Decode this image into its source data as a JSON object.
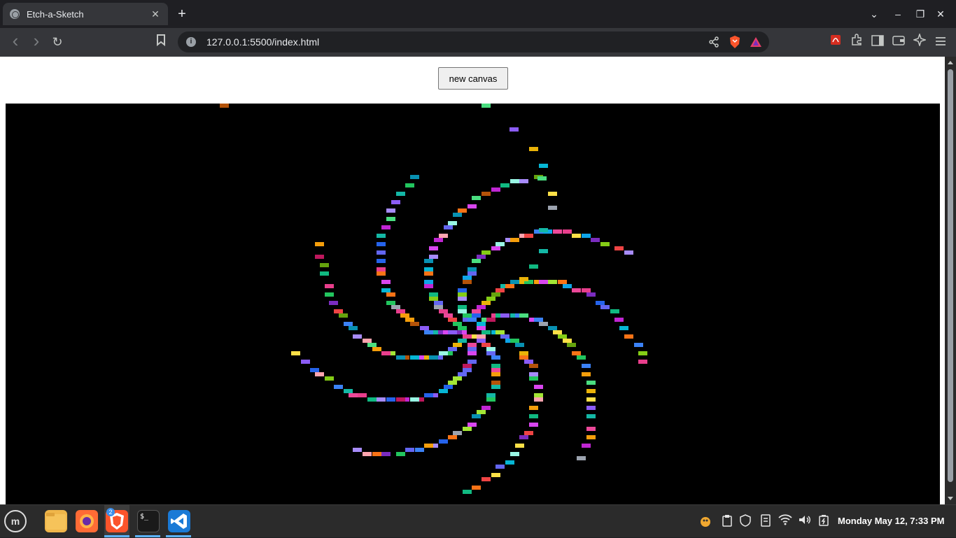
{
  "browser": {
    "tab_title": "Etch-a-Sketch",
    "tab_close": "✕",
    "new_tab": "+",
    "url": "127.0.0.1:5500/index.html",
    "info_icon_glyph": "i",
    "back_glyph": "‹",
    "forward_glyph": "›",
    "reload_glyph": "↻",
    "window_minimize": "–",
    "window_restore": "❐",
    "window_close": "✕",
    "tab_list_glyph": "⌄"
  },
  "page": {
    "new_canvas_label": "new canvas"
  },
  "colors": {
    "canvas_background": "#000000",
    "page_background": "#ffffff",
    "accent_blue": "#5bb3ff",
    "brave_orange": "#fb542b"
  },
  "sketch_palette": [
    "#e83e8c",
    "#7b2cbf",
    "#22c55e",
    "#06b6d4",
    "#f59e0b",
    "#ef4444",
    "#3b82f6",
    "#a3e635",
    "#8b5cf6",
    "#ec4899",
    "#14b8a6",
    "#84cc16",
    "#f97316",
    "#6366f1",
    "#d946ef",
    "#0ea5e9",
    "#10b981",
    "#eab308",
    "#9ca3af",
    "#a78bfa",
    "#fda4af",
    "#4ade80",
    "#2563eb",
    "#b45309",
    "#65a30d",
    "#be185d",
    "#0891b2",
    "#c026d3",
    "#fde047",
    "#99f6e4"
  ],
  "taskbar": {
    "menu_glyph": "m",
    "brave_badge": "2",
    "terminal_glyph": "$_",
    "clock": "Monday May 12, 7:33 PM"
  }
}
